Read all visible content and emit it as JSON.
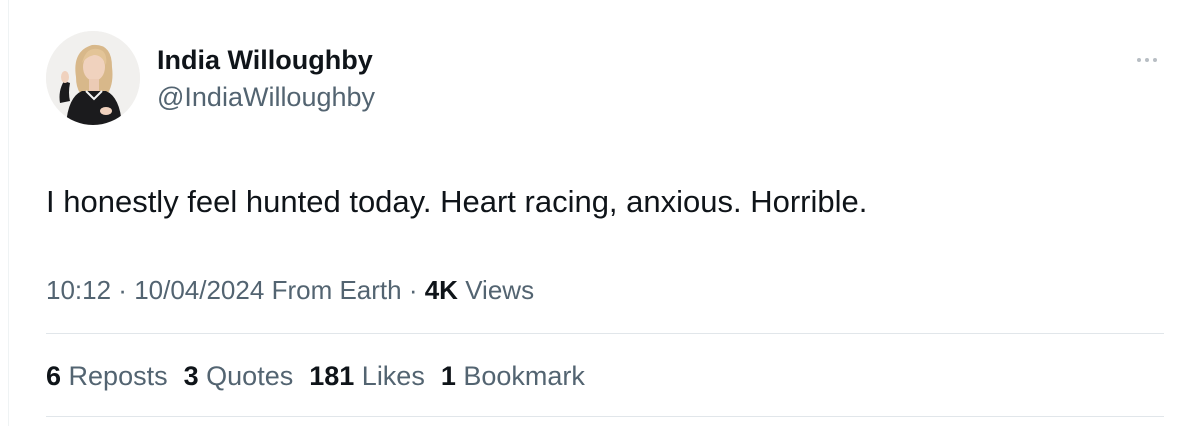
{
  "author": {
    "display_name": "India Willoughby",
    "handle": "@IndiaWilloughby"
  },
  "tweet": {
    "text": "I honestly feel hunted today. Heart racing, anxious. Horrible."
  },
  "meta": {
    "time": "10:12",
    "separator": " · ",
    "date": "10/04/2024",
    "source": "From Earth",
    "views_count": "4K",
    "views_label": "Views"
  },
  "stats": {
    "reposts": {
      "count": "6",
      "label": "Reposts"
    },
    "quotes": {
      "count": "3",
      "label": "Quotes"
    },
    "likes": {
      "count": "181",
      "label": "Likes"
    },
    "bookmarks": {
      "count": "1",
      "label": "Bookmark"
    }
  },
  "icons": {
    "more": "more-horizontal-icon"
  },
  "colors": {
    "text_primary": "#0f1419",
    "text_secondary": "#536471",
    "divider": "#e1e6ea"
  }
}
